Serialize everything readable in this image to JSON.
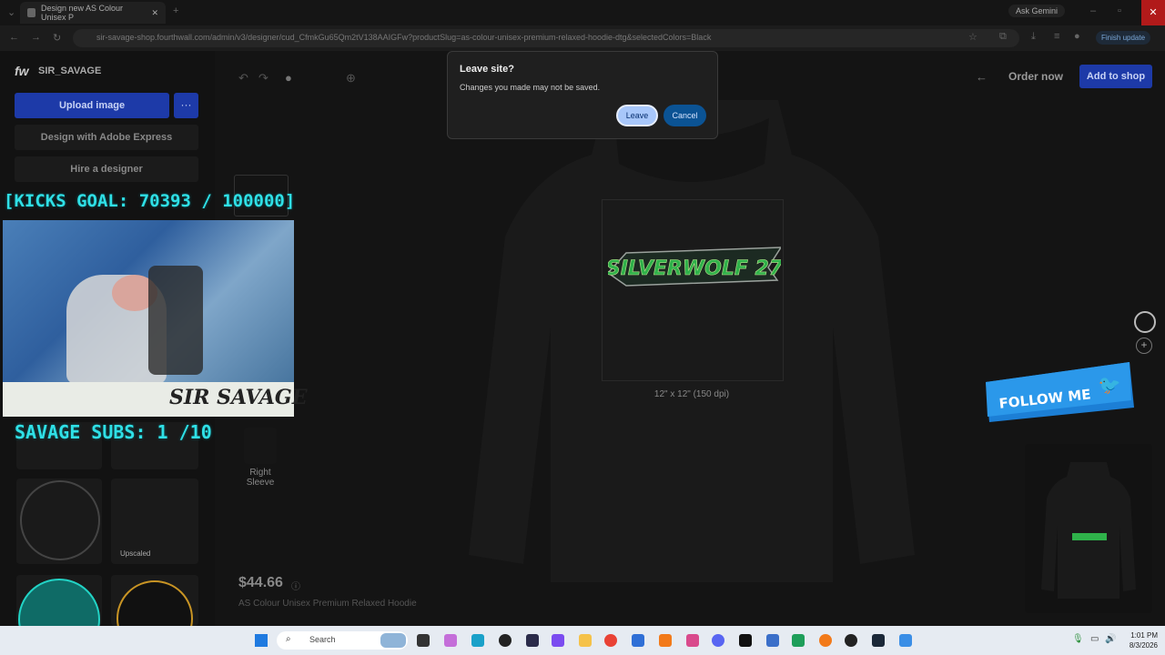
{
  "browser": {
    "tab_title": "Design new AS Colour Unisex P",
    "url": "sir-savage-shop.fourthwall.com/admin/v3/designer/cud_CfmkGu65Qm2tV138AAIGFw?productSlug=as-colour-unisex-premium-relaxed-hoodie-dtg&selectedColors=Black",
    "gemini": "Ask Gemini",
    "finish_update": "Finish update"
  },
  "app": {
    "logo": "fw",
    "store_name": "SIR_SAVAGE",
    "upload_label": "Upload image",
    "adobe_label": "Design with Adobe Express",
    "hire_label": "Hire a designer",
    "upscaled": "Upscaled",
    "order_now": "Order now",
    "add_to_shop": "Add to shop",
    "print_size": "12\" x 12\" (150 dpi)",
    "sleeve": "Right Sleeve",
    "price": "$44.66",
    "product_name": "AS Colour Unisex Premium Relaxed Hoodie",
    "design_text": "SILVERWOLF 27"
  },
  "dialog": {
    "title": "Leave site?",
    "message": "Changes you made may not be saved.",
    "leave": "Leave",
    "cancel": "Cancel"
  },
  "overlay": {
    "kicks_goal": "[KICKS GOAL: 70393 / 100000]",
    "subs": "SAVAGE SUBS: 1  /10",
    "webcam_logo": "SIR SAVAGE",
    "follow": "FOLLOW ME"
  },
  "taskbar": {
    "search": "Search",
    "time": "1:01 PM",
    "date": "8/3/2026"
  }
}
